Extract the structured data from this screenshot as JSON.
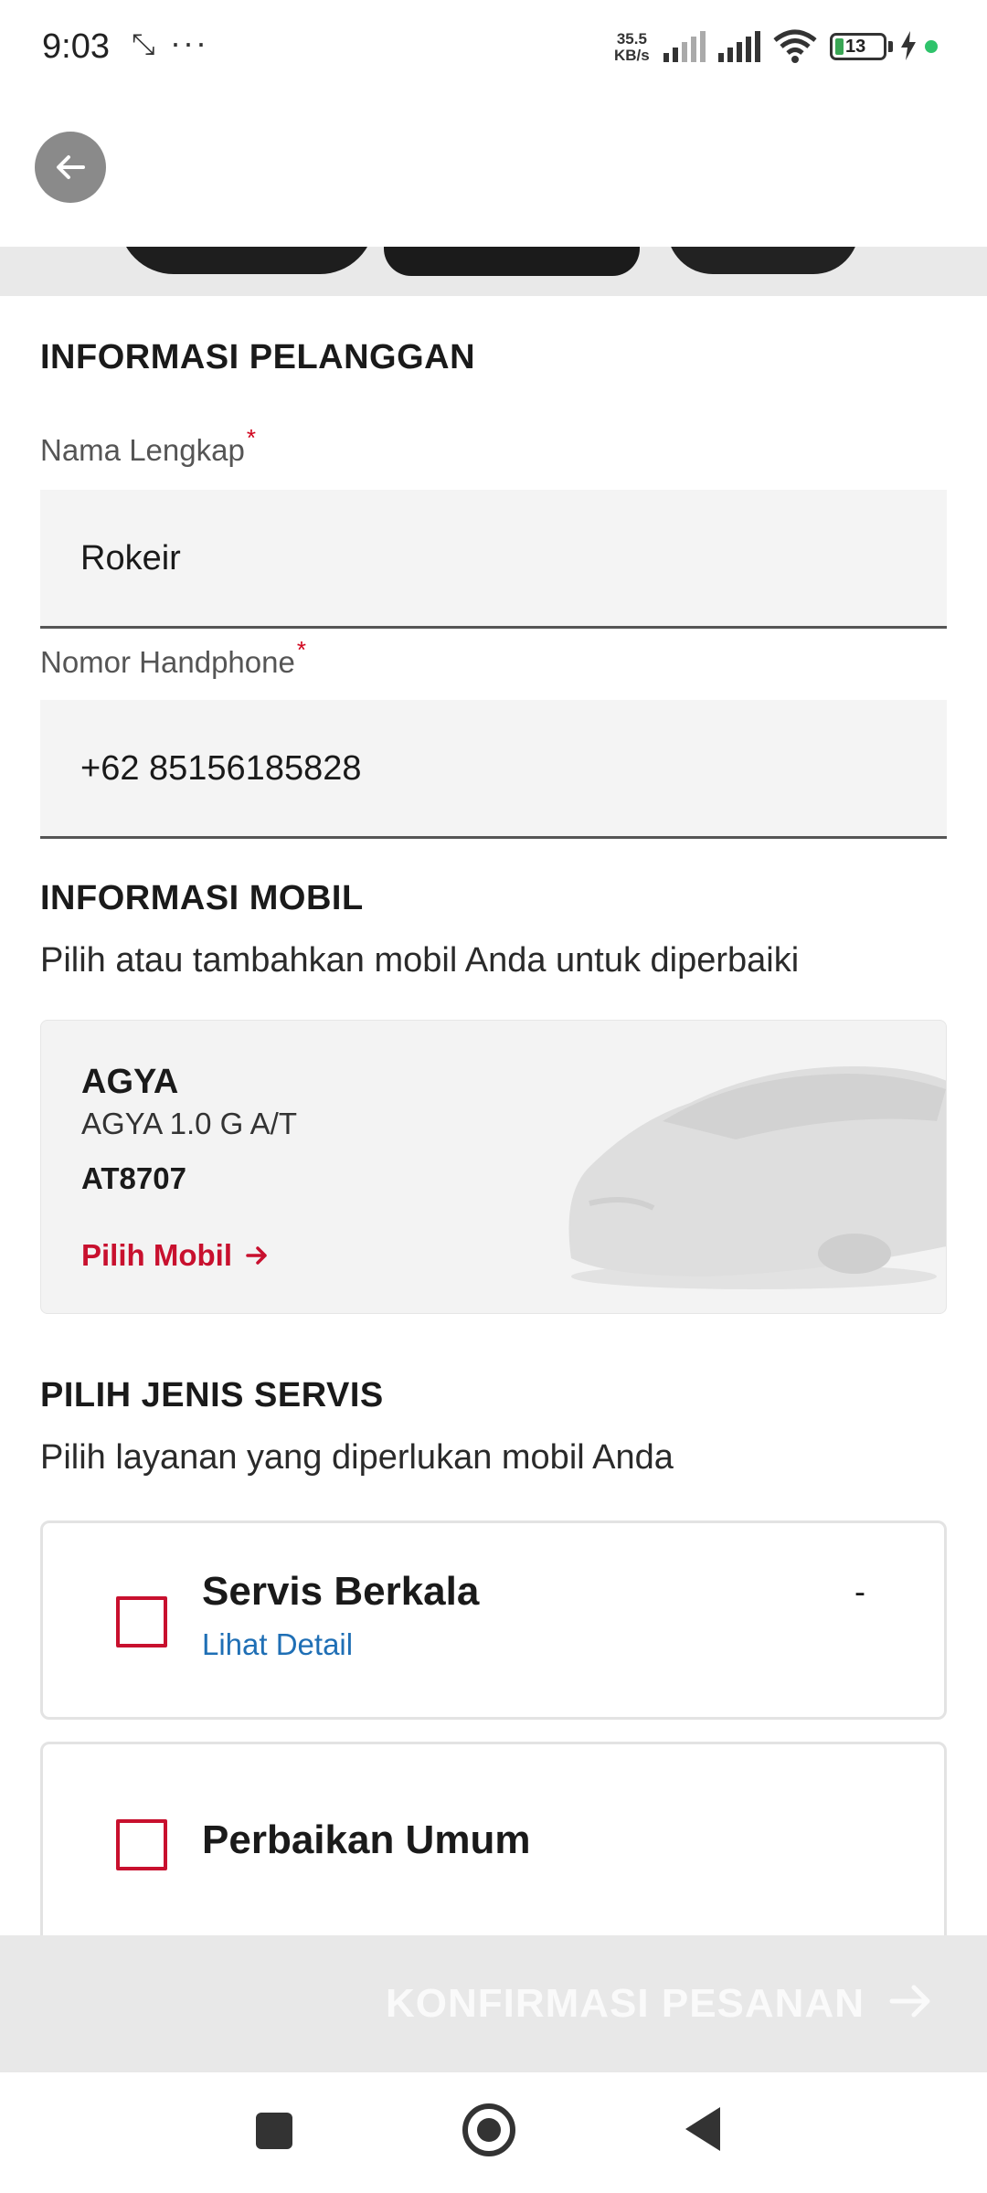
{
  "status_bar": {
    "time": "9:03",
    "sync_glyph": "⤡",
    "more_glyph": "···",
    "net_speed_value": "35.5",
    "net_speed_unit": "KB/s",
    "battery_level": "13",
    "icons": [
      "signal-icon",
      "signal-icon",
      "wifi-icon",
      "battery-icon",
      "charging-icon"
    ]
  },
  "top_bar": {
    "back_icon": "arrow-left-icon"
  },
  "customer": {
    "section_title": "INFORMASI PELANGGAN",
    "name_label": "Nama Lengkap",
    "name_value": "Rokeir",
    "phone_label": "Nomor Handphone",
    "phone_value": "+62  85156185828",
    "required_mark": "*"
  },
  "car": {
    "section_title": "INFORMASI MOBIL",
    "section_subtitle": "Pilih atau tambahkan mobil Anda untuk diperbaiki",
    "model": "AGYA",
    "variant": "AGYA 1.0 G A/T",
    "plate": "AT8707",
    "select_link": "Pilih Mobil"
  },
  "service": {
    "section_title": "PILIH JENIS SERVIS",
    "section_subtitle": "Pilih layanan yang diperlukan mobil Anda",
    "options": [
      {
        "title": "Servis Berkala",
        "detail_link": "Lihat Detail",
        "price": "-",
        "checked": false
      },
      {
        "title": "Perbaikan Umum",
        "checked": false
      }
    ]
  },
  "footer": {
    "confirm_label": "KONFIRMASI PESANAN"
  },
  "colors": {
    "accent_red": "#c8102e",
    "link_blue": "#1f6fb5",
    "disabled_bar": "#e8e8e8"
  }
}
